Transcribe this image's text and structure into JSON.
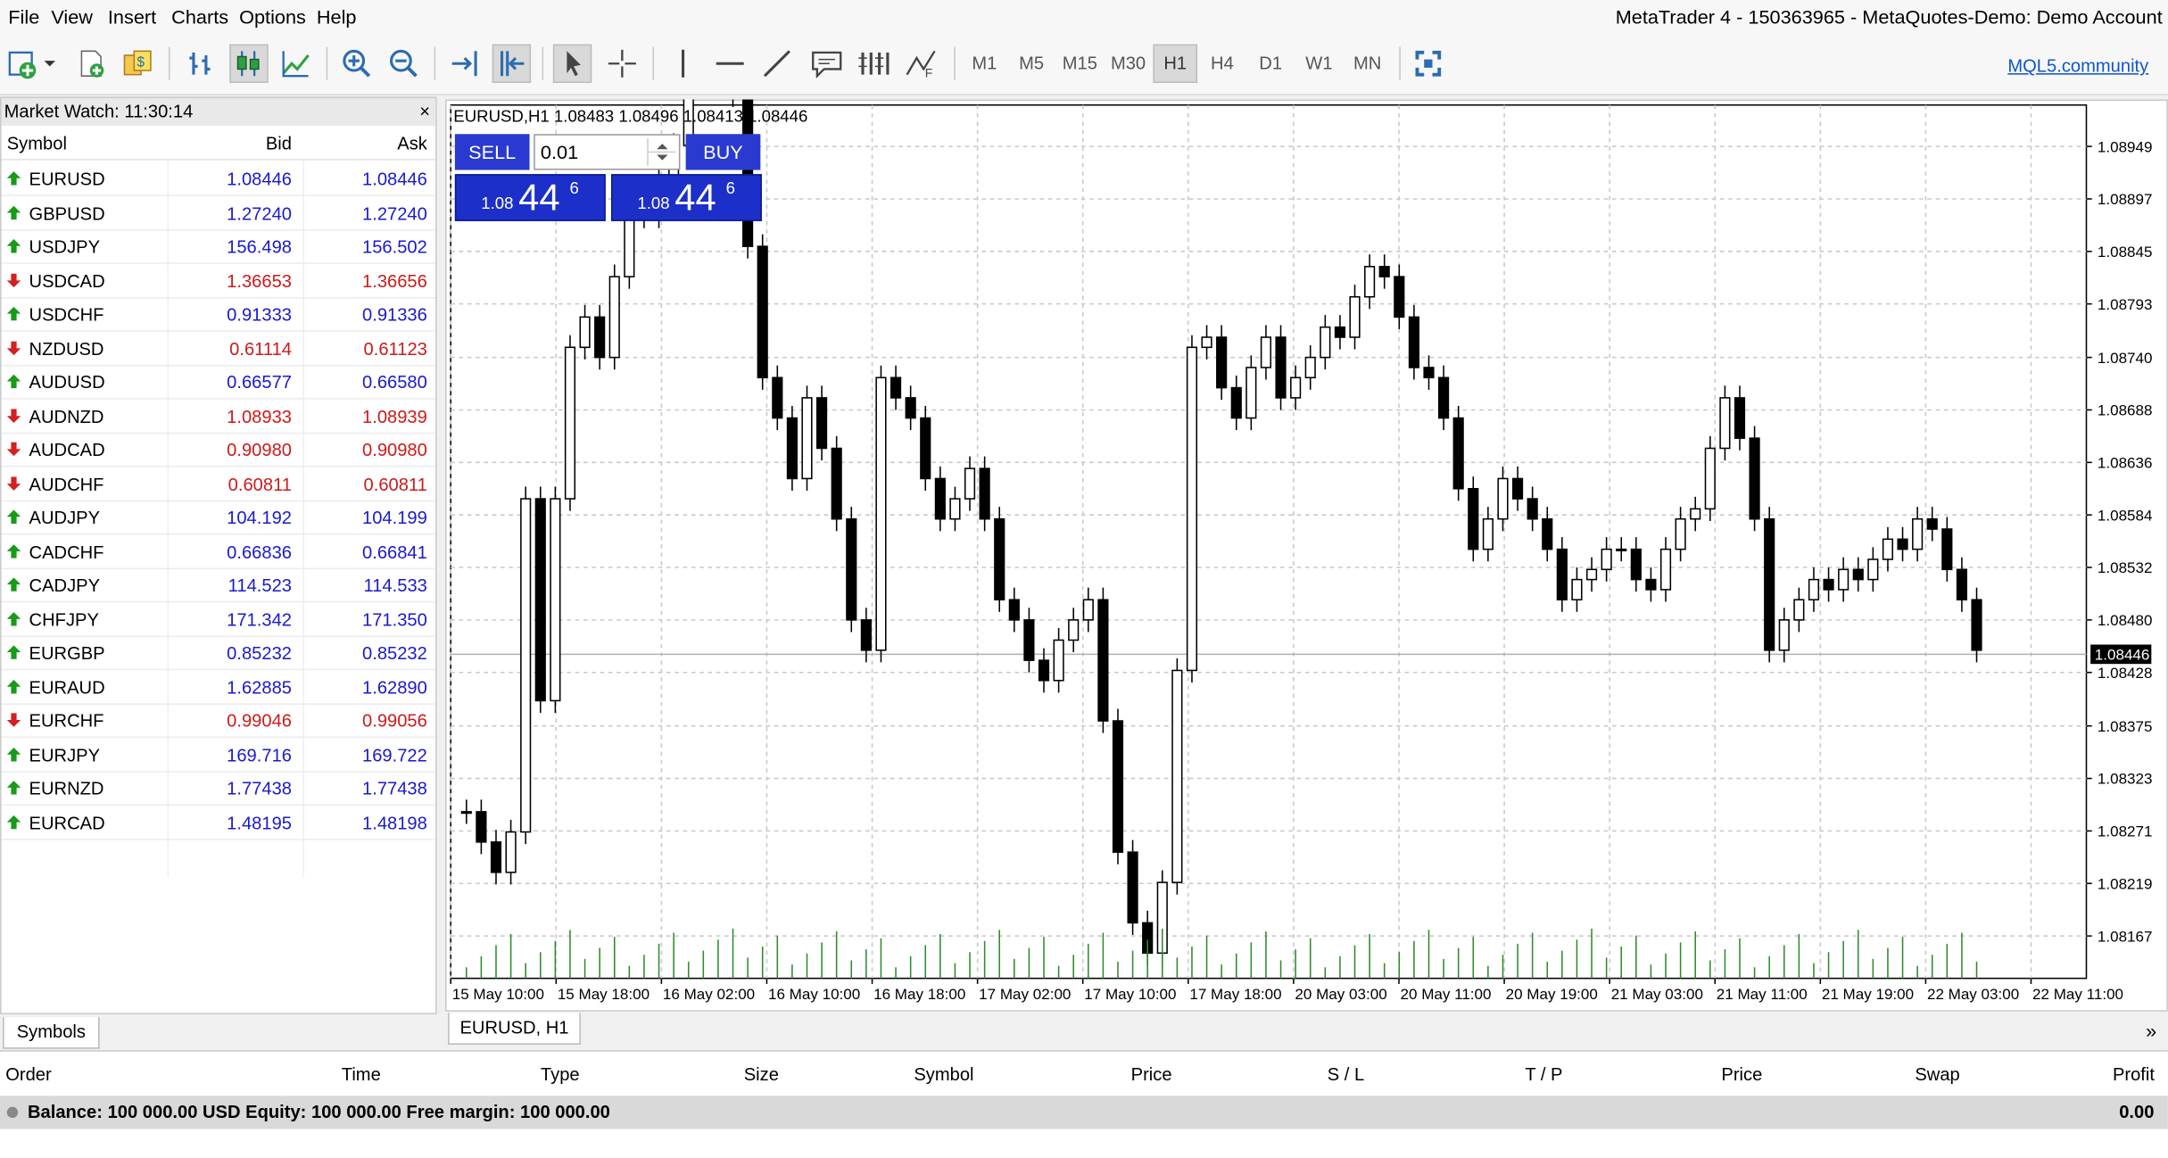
{
  "menu": [
    "File",
    "View",
    "Insert",
    "Charts",
    "Options",
    "Help"
  ],
  "window_title": "MetaTrader 4 - 150363965 - MetaQuotes-Demo: Demo Account",
  "toolbar": {
    "timeframes": [
      "M1",
      "M5",
      "M15",
      "M30",
      "H1",
      "H4",
      "D1",
      "W1",
      "MN"
    ],
    "active_timeframe": "H1",
    "community_link": "MQL5.community"
  },
  "market_watch": {
    "title": "Market Watch: 11:30:14",
    "close": "×",
    "columns": {
      "symbol": "Symbol",
      "bid": "Bid",
      "ask": "Ask"
    },
    "rows": [
      {
        "symbol": "EURUSD",
        "bid": "1.08446",
        "ask": "1.08446",
        "dir": "up"
      },
      {
        "symbol": "GBPUSD",
        "bid": "1.27240",
        "ask": "1.27240",
        "dir": "up"
      },
      {
        "symbol": "USDJPY",
        "bid": "156.498",
        "ask": "156.502",
        "dir": "up"
      },
      {
        "symbol": "USDCAD",
        "bid": "1.36653",
        "ask": "1.36656",
        "dir": "down"
      },
      {
        "symbol": "USDCHF",
        "bid": "0.91333",
        "ask": "0.91336",
        "dir": "up"
      },
      {
        "symbol": "NZDUSD",
        "bid": "0.61114",
        "ask": "0.61123",
        "dir": "down"
      },
      {
        "symbol": "AUDUSD",
        "bid": "0.66577",
        "ask": "0.66580",
        "dir": "up"
      },
      {
        "symbol": "AUDNZD",
        "bid": "1.08933",
        "ask": "1.08939",
        "dir": "down"
      },
      {
        "symbol": "AUDCAD",
        "bid": "0.90980",
        "ask": "0.90980",
        "dir": "down"
      },
      {
        "symbol": "AUDCHF",
        "bid": "0.60811",
        "ask": "0.60811",
        "dir": "down"
      },
      {
        "symbol": "AUDJPY",
        "bid": "104.192",
        "ask": "104.199",
        "dir": "up"
      },
      {
        "symbol": "CADCHF",
        "bid": "0.66836",
        "ask": "0.66841",
        "dir": "up"
      },
      {
        "symbol": "CADJPY",
        "bid": "114.523",
        "ask": "114.533",
        "dir": "up"
      },
      {
        "symbol": "CHFJPY",
        "bid": "171.342",
        "ask": "171.350",
        "dir": "up"
      },
      {
        "symbol": "EURGBP",
        "bid": "0.85232",
        "ask": "0.85232",
        "dir": "up"
      },
      {
        "symbol": "EURAUD",
        "bid": "1.62885",
        "ask": "1.62890",
        "dir": "up"
      },
      {
        "symbol": "EURCHF",
        "bid": "0.99046",
        "ask": "0.99056",
        "dir": "down"
      },
      {
        "symbol": "EURJPY",
        "bid": "169.716",
        "ask": "169.722",
        "dir": "up"
      },
      {
        "symbol": "EURNZD",
        "bid": "1.77438",
        "ask": "1.77438",
        "dir": "up"
      },
      {
        "symbol": "EURCAD",
        "bid": "1.48195",
        "ask": "1.48198",
        "dir": "up"
      }
    ],
    "tab_label": "Symbols"
  },
  "colors": {
    "up": "#1a9a1a",
    "down": "#d42020",
    "price_up": "#1a1acc",
    "price_down": "#cc1a1a",
    "trade_button": "#2a3ad0"
  },
  "chart": {
    "info": "EURUSD,H1  1.08483 1.08496 1.08413 1.08446",
    "tab_label": "EURUSD, H1",
    "scroll_arrow": "»",
    "one_click": {
      "sell_label": "SELL",
      "buy_label": "BUY",
      "lot": "0.01",
      "sell_price": {
        "prefix": "1.08",
        "big": "44",
        "sup": "6"
      },
      "buy_price": {
        "prefix": "1.08",
        "big": "44",
        "sup": "6"
      }
    }
  },
  "chart_data": {
    "type": "candlestick",
    "symbol": "EURUSD",
    "timeframe": "H1",
    "y_ticks": [
      "1.08949",
      "1.08897",
      "1.08845",
      "1.08793",
      "1.08740",
      "1.08688",
      "1.08636",
      "1.08584",
      "1.08532",
      "1.08480",
      "1.08428",
      "1.08375",
      "1.08323",
      "1.08271",
      "1.08219",
      "1.08167"
    ],
    "current_price": "1.08446",
    "x_ticks": [
      "15 May 10:00",
      "15 May 18:00",
      "16 May 02:00",
      "16 May 10:00",
      "16 May 18:00",
      "17 May 02:00",
      "17 May 10:00",
      "17 May 18:00",
      "20 May 03:00",
      "20 May 11:00",
      "20 May 19:00",
      "21 May 03:00",
      "21 May 11:00",
      "21 May 19:00",
      "22 May 03:00",
      "22 May 11:00"
    ],
    "ylim": [
      1.08125,
      1.0899
    ],
    "grid": true,
    "close_series": [
      1.0829,
      1.0826,
      1.0823,
      1.0827,
      1.086,
      1.084,
      1.086,
      1.0875,
      1.0878,
      1.0874,
      1.0882,
      1.0888,
      1.0888,
      1.0892,
      1.0895,
      1.0902,
      1.0912,
      1.0908,
      1.09,
      1.0885,
      1.0872,
      1.0868,
      1.0862,
      1.087,
      1.0865,
      1.0858,
      1.0848,
      1.0845,
      1.0872,
      1.087,
      1.0868,
      1.0862,
      1.0858,
      1.086,
      1.0863,
      1.0858,
      1.085,
      1.0848,
      1.0844,
      1.0842,
      1.0846,
      1.0848,
      1.085,
      1.0838,
      1.0825,
      1.0818,
      1.0815,
      1.0822,
      1.0843,
      1.0875,
      1.0876,
      1.0871,
      1.0868,
      1.0873,
      1.0876,
      1.087,
      1.0872,
      1.0874,
      1.0877,
      1.0876,
      1.088,
      1.0883,
      1.0882,
      1.0878,
      1.0873,
      1.0872,
      1.0868,
      1.0861,
      1.0855,
      1.0858,
      1.0862,
      1.086,
      1.0858,
      1.0855,
      1.085,
      1.0852,
      1.0853,
      1.0855,
      1.0855,
      1.0852,
      1.0851,
      1.0855,
      1.0858,
      1.0859,
      1.0865,
      1.087,
      1.0866,
      1.0858,
      1.0845,
      1.0848,
      1.085,
      1.0852,
      1.0851,
      1.0853,
      1.0852,
      1.0854,
      1.0856,
      1.0855,
      1.0858,
      1.0857,
      1.0853,
      1.085,
      1.0845
    ]
  },
  "terminal": {
    "columns": [
      "Order",
      "Time",
      "Type",
      "Size",
      "Symbol",
      "Price",
      "S / L",
      "T / P",
      "Price",
      "Swap",
      "Profit"
    ],
    "balance_text": "Balance: 100 000.00 USD  Equity: 100 000.00  Free margin: 100 000.00",
    "profit": "0.00"
  }
}
